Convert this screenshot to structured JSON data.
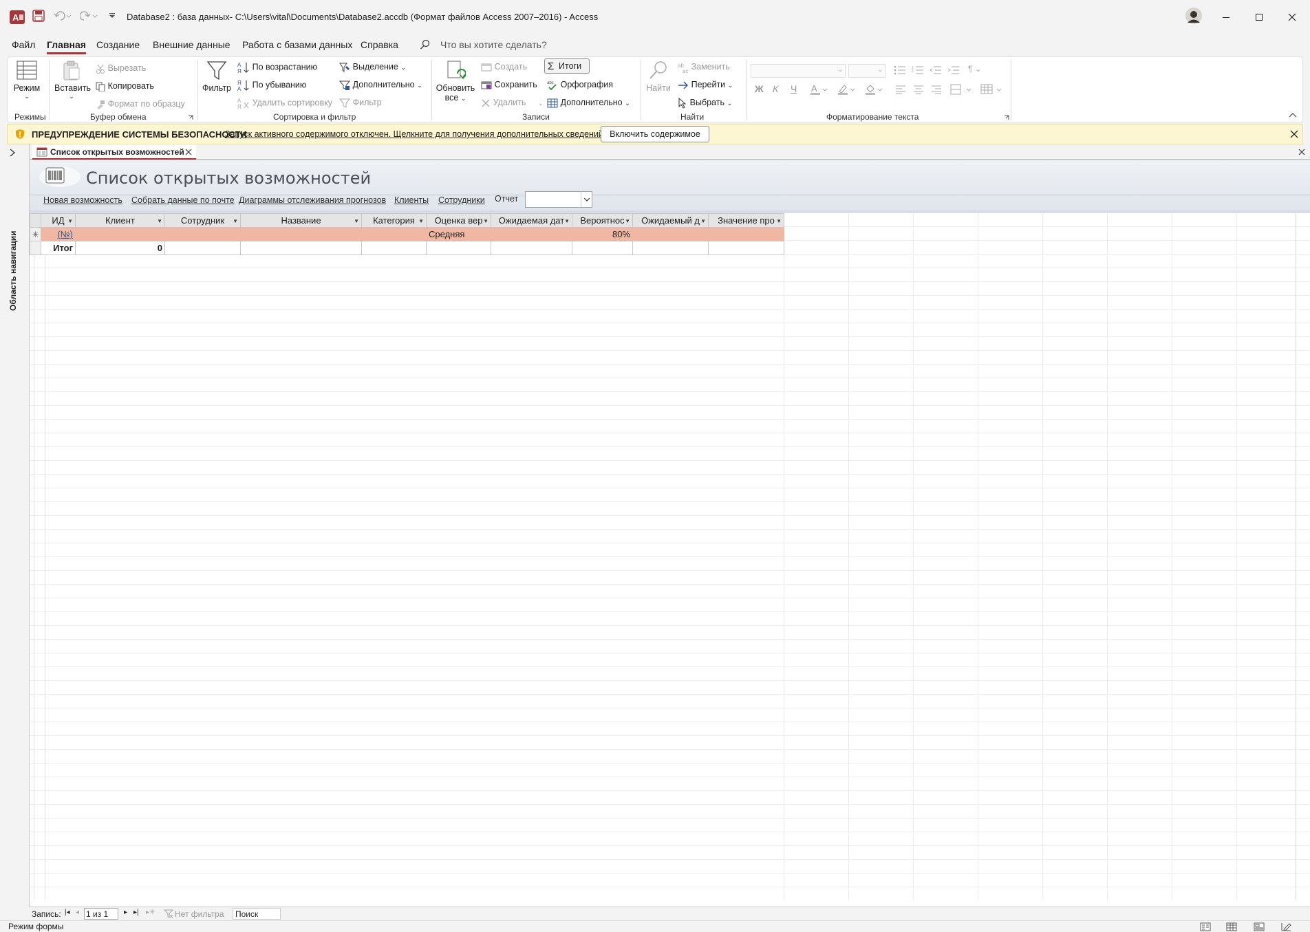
{
  "titlebar": {
    "title": "Database2 : база данных- C:\\Users\\vital\\Documents\\Database2.accdb (Формат файлов Access 2007–2016)  -  Access"
  },
  "menu": {
    "tabs": [
      "Файл",
      "Главная",
      "Создание",
      "Внешние данные",
      "Работа с базами данных",
      "Справка"
    ],
    "active_tab": "Главная",
    "tell_me": "Что вы хотите сделать?"
  },
  "ribbon": {
    "views": {
      "mode": "Режим",
      "group": "Режимы"
    },
    "clipboard": {
      "paste": "Вставить",
      "cut": "Вырезать",
      "copy": "Копировать",
      "format_painter": "Формат по образцу",
      "group": "Буфер обмена"
    },
    "sortfilter": {
      "filter": "Фильтр",
      "ascending": "По возрастанию",
      "descending": "По убыванию",
      "remove_sort": "Удалить сортировку",
      "selection": "Выделение",
      "advanced": "Дополнительно",
      "toggle_filter": "Фильтр",
      "group": "Сортировка и фильтр"
    },
    "records": {
      "refresh_1": "Обновить",
      "refresh_2": "все",
      "new": "Создать",
      "save": "Сохранить",
      "delete": "Удалить",
      "totals": "Итоги",
      "spelling": "Орфография",
      "more": "Дополнительно",
      "group": "Записи"
    },
    "find": {
      "find": "Найти",
      "replace": "Заменить",
      "goto": "Перейти",
      "select": "Выбрать",
      "group": "Найти"
    },
    "textformat": {
      "bold": "Ж",
      "italic": "К",
      "underline": "Ч",
      "group": "Форматирование текста"
    }
  },
  "security": {
    "title": "ПРЕДУПРЕЖДЕНИЕ СИСТЕМЫ БЕЗОПАСНОСТИ",
    "message": "Запуск активного содержимого отключен. Щелкните для получения дополнительных сведений.",
    "button": "Включить содержимое"
  },
  "navpane": {
    "label": "Область навигации"
  },
  "document": {
    "tab_label": "Список открытых возможностей",
    "form_title": "Список открытых возможностей",
    "links": [
      "Новая возможность",
      "Собрать данные по почте",
      "Диаграммы отслеживания прогнозов",
      "Клиенты",
      "Сотрудники",
      "Отчет"
    ],
    "report_value": ""
  },
  "datasheet": {
    "columns": [
      "ИД",
      "Клиент",
      "Сотрудник",
      "Название",
      "Категория",
      "Оценка вер",
      "Ожидаемая дат",
      "Вероятнос",
      "Ожидаемый д",
      "Значение про"
    ],
    "new_row": {
      "id": "(№)",
      "rating": "Средняя",
      "probability": "80%"
    },
    "new_row_marker": "✳",
    "total_row": {
      "label": "Итог",
      "client_count": "0"
    }
  },
  "record_nav": {
    "label": "Запись:",
    "position": "1 из 1",
    "filter": "Нет фильтра",
    "search": "Поиск"
  },
  "status": {
    "text": "Режим формы"
  }
}
